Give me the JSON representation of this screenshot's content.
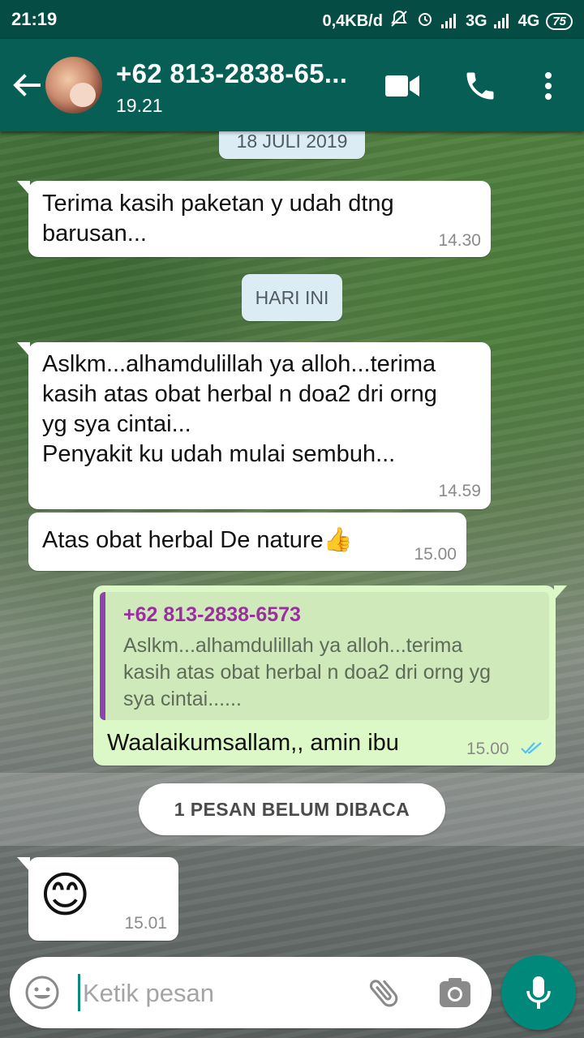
{
  "status_bar": {
    "time": "21:19",
    "speed": "0,4KB/d",
    "net1": "3G",
    "net2": "4G",
    "battery": "75"
  },
  "header": {
    "contact_name": "+62 813-2838-65...",
    "last_seen": "19.21",
    "icons": [
      "back-arrow-icon",
      "video-call-icon",
      "phone-icon",
      "more-vert-icon"
    ]
  },
  "chat": {
    "date_chip_1": "18 JULI 2019",
    "msg1": {
      "text": "Terima kasih paketan y udah dtng\nbarusan...",
      "time": "14.30"
    },
    "date_chip_2": "HARI INI",
    "msg2": {
      "text": "Aslkm...alhamdulillah ya alloh...terima\nkasih atas obat herbal n doa2 dri orng\nyg sya cintai...\nPenyakit ku udah mulai sembuh...",
      "time": "14.59"
    },
    "msg3": {
      "text": "Atas obat herbal De nature",
      "emoji": "👍",
      "time": "15.00"
    },
    "reply": {
      "quote_name": "+62 813-2838-6573",
      "quote_text": "Aslkm...alhamdulillah ya alloh...terima\nkasih atas obat herbal n doa2 dri orng yg\nsya cintai......",
      "text": "Waalaikumsallam,, amin ibu",
      "time": "15.00",
      "status": "read"
    },
    "unread_label": "1 PESAN BELUM DIBACA",
    "msg4": {
      "emoji": "😊",
      "time": "15.01"
    }
  },
  "composer": {
    "placeholder": "Ketik pesan"
  },
  "colors": {
    "header": "#075e54",
    "status_bar": "#054d44",
    "outgoing": "#dcf8c6",
    "date_chip": "#dcecf5",
    "mic": "#00897b",
    "read_ticks": "#4fc3f7"
  }
}
